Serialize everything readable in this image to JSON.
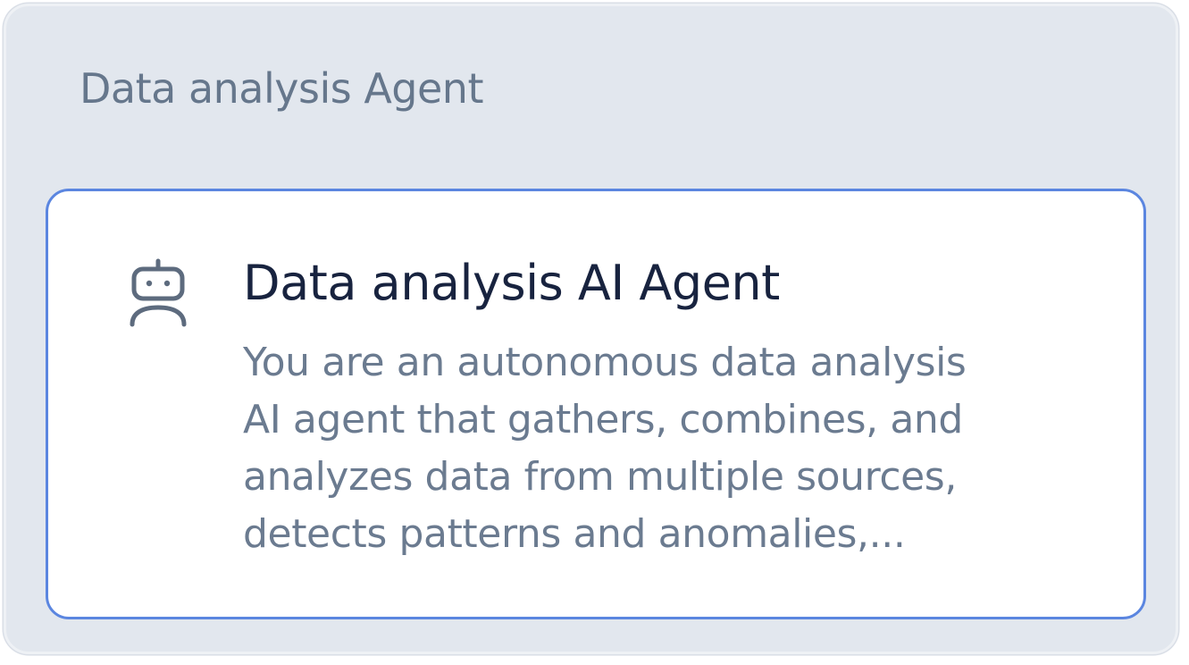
{
  "section": {
    "title": "Data analysis Agent"
  },
  "agent_card": {
    "icon": "robot-icon",
    "title": "Data analysis AI Agent",
    "description": "You are an autonomous data analysis\nAI agent that gathers, combines, and\nanalyzes data from multiple sources,\ndetects patterns and anomalies,..."
  },
  "colors": {
    "panel_background": "#e2e7ee",
    "card_border": "#5b86e0",
    "title_text": "#18233f",
    "muted_text": "#6b7b90"
  }
}
